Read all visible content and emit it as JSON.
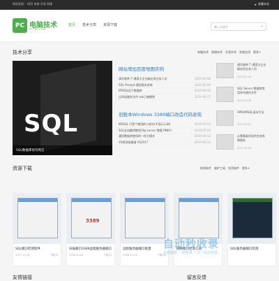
{
  "topbar": {
    "left": "网站导航： 网页 系统 开发 网络",
    "right": "收藏本站"
  },
  "header": {
    "logo": "PC",
    "title": "电脑技术",
    "subtitle": "PCTEK.COM",
    "nav": [
      "首页",
      "技术分享",
      "资源下载"
    ],
    "search_placeholder": "输入关键字",
    "search_icon": "search-icon"
  },
  "tech": {
    "title": "技术分享",
    "links": [
      "电脑技术",
      "网络技术",
      "开发技术",
      "系统应用",
      "更多+"
    ],
    "feature_caption": "SQL数据库语句简洁",
    "feature_text": "SQL",
    "groups": [
      {
        "heading": "网站增加百度地图实例",
        "rows": [
          {
            "title": "请问各种了-通用大企业级应用业务人员",
            "date": "2022-02-06"
          },
          {
            "title": "SQL Prompt 通用版本安装",
            "date": "2022-02-06"
          },
          {
            "title": "MSSQL用于数据库",
            "date": "2019-06-26"
          },
          {
            "title": "让网站服务文件.ask已被删除",
            "date": "2019-06-25"
          }
        ]
      },
      {
        "heading": "旧版本Windows 3389端口改造代码发现",
        "rows": [
          {
            "title": "MSSQL 只是个使用的小部分(不显示示例)",
            "date": "2019-07-21"
          },
          {
            "title": "SQL全站翻译教程(Sql server 数据 INNO)",
            "date": "2019-07-20"
          },
          {
            "title": "通用数据库使用的一样大模式",
            "date": "2019-06-13"
          },
          {
            "title": "VS常用快捷键 VS2017",
            "date": "2019-06-13"
          }
        ]
      }
    ],
    "side": [
      {
        "title": "请问各种了-通用大企业级应用业务人员",
        "date": "2022-02-06"
      },
      {
        "title": "SQL Server 数据库常用命令操作文件",
        "date": "2019-06-26"
      },
      {
        "title": "APROMSQL语句写法",
        "date": "2019-06-01"
      },
      {
        "title": "从零基础实现的生成系统服务",
        "date": "2017-12-05"
      }
    ]
  },
  "downloads": {
    "title": "资源下载",
    "links": [
      "检测软件",
      "维护工具",
      "实用软件",
      "更多+"
    ],
    "cards": [
      {
        "title": "SQL端口检测软件",
        "date": "2017-12-08",
        "count": "下载:47"
      },
      {
        "title": "扫描端口3389远程服务器端口",
        "date": "2016-10-04",
        "count": "下载:41"
      },
      {
        "title": "远程服务器端口批量",
        "date": "2016-10-11",
        "count": "下载:44"
      },
      {
        "title": "网络端口检测工具",
        "date": "",
        "count": ""
      },
      {
        "title": "SQL服务器端口检测",
        "date": "",
        "count": ""
      }
    ],
    "card2_value": "3389"
  },
  "watermark": {
    "main": "自动秒收录",
    "sub": "自助链接 一键收录 一次一钻的收录"
  },
  "footer": {
    "left": "友情链接",
    "right": "留言反馈"
  }
}
